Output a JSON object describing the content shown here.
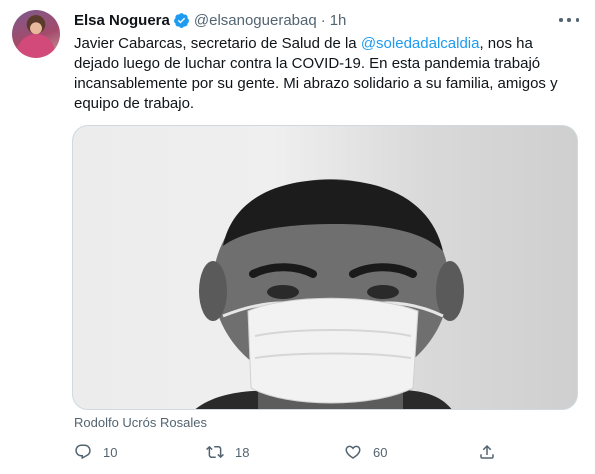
{
  "tweet": {
    "author_name": "Elsa Noguera",
    "handle": "@elsanoguerabaq",
    "separator": "·",
    "time": "1h",
    "text_before_mention": "Javier Cabarcas, secretario de Salud de la ",
    "mention": "@soledadalcaldia",
    "text_after_mention": ", nos ha dejado luego de luchar contra la COVID-19. En esta pandemia trabajó incansablemente por su gente. Mi abrazo solidario a su familia, amigos y equipo de trabajo.",
    "media_caption": "Rodolfo Ucrós Rosales"
  },
  "actions": {
    "reply_count": "10",
    "retweet_count": "18",
    "like_count": "60"
  },
  "icons": {
    "verified": "verified-badge-icon",
    "more": "more-horizontal-icon",
    "reply": "reply-icon",
    "retweet": "retweet-icon",
    "like": "heart-icon",
    "share": "share-icon"
  },
  "colors": {
    "accent": "#1d9bf0",
    "text": "#0f1419",
    "secondary": "#536471"
  }
}
